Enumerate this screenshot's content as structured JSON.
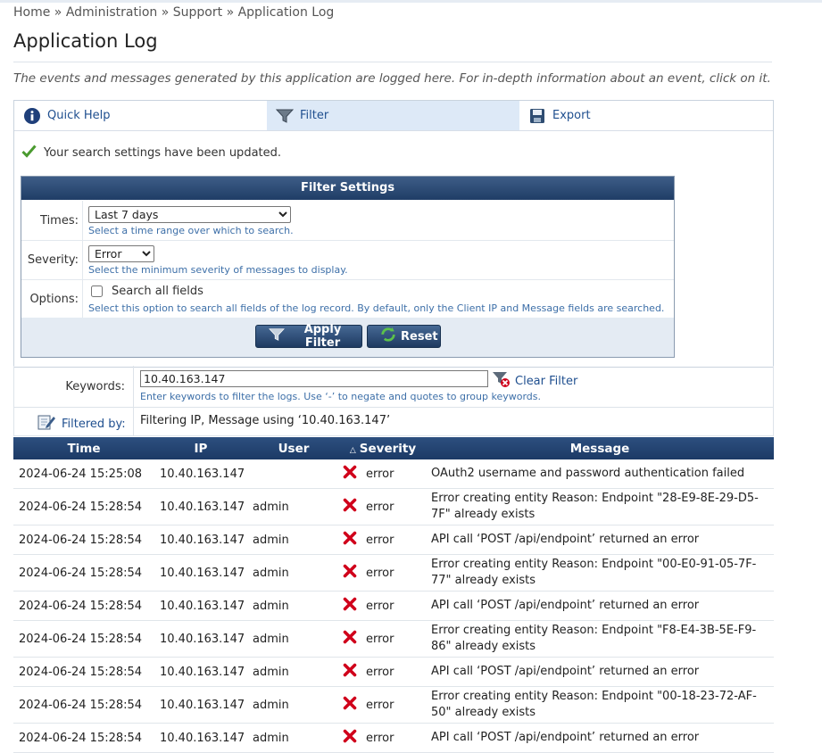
{
  "breadcrumb": {
    "home": "Home",
    "sep": "»",
    "administration": "Administration",
    "support": "Support",
    "current": "Application Log"
  },
  "page": {
    "title": "Application Log",
    "intro": "The events and messages generated by this application are logged here. For in-depth information about an event, click on it."
  },
  "tabs": [
    {
      "label": "Quick Help",
      "icon": "info-icon"
    },
    {
      "label": "Filter",
      "icon": "filter-icon"
    },
    {
      "label": "Export",
      "icon": "save-icon"
    }
  ],
  "status": {
    "message": "Your search settings have been updated."
  },
  "filter_settings": {
    "title": "Filter Settings",
    "times": {
      "label": "Times:",
      "value": "Last 7 days",
      "hint": "Select a time range over which to search."
    },
    "severity": {
      "label": "Severity:",
      "value": "Error",
      "hint": "Select the minimum severity of messages to display."
    },
    "options": {
      "label": "Options:",
      "checkbox_label": "Search all fields",
      "checked": false,
      "hint": "Select this option to search all fields of the log record. By default, only the Client IP and Message fields are searched."
    },
    "apply_label": "Apply Filter",
    "reset_label": "Reset"
  },
  "keywords": {
    "label": "Keywords:",
    "value": "10.40.163.147",
    "clear_label": "Clear Filter",
    "hint": "Enter keywords to filter the logs. Use ‘-’ to negate and quotes to group keywords."
  },
  "filtered_by": {
    "label": "Filtered by:",
    "text": "Filtering IP, Message using ‘10.40.163.147’"
  },
  "table": {
    "columns": {
      "time": "Time",
      "ip": "IP",
      "user": "User",
      "severity": "Severity",
      "message": "Message"
    },
    "severity_sort_indicator": "△",
    "rows": [
      {
        "time": "2024-06-24 15:25:08",
        "ip": "10.40.163.147",
        "user": "",
        "severity": "error",
        "message": "OAuth2 username and password authentication failed"
      },
      {
        "time": "2024-06-24 15:28:54",
        "ip": "10.40.163.147",
        "user": "admin",
        "severity": "error",
        "message": "Error creating entity Reason: Endpoint \"28-E9-8E-29-D5-7F\" already exists"
      },
      {
        "time": "2024-06-24 15:28:54",
        "ip": "10.40.163.147",
        "user": "admin",
        "severity": "error",
        "message": "API call ‘POST /api/endpoint’ returned an error"
      },
      {
        "time": "2024-06-24 15:28:54",
        "ip": "10.40.163.147",
        "user": "admin",
        "severity": "error",
        "message": "Error creating entity Reason: Endpoint \"00-E0-91-05-7F-77\" already exists"
      },
      {
        "time": "2024-06-24 15:28:54",
        "ip": "10.40.163.147",
        "user": "admin",
        "severity": "error",
        "message": "API call ‘POST /api/endpoint’ returned an error"
      },
      {
        "time": "2024-06-24 15:28:54",
        "ip": "10.40.163.147",
        "user": "admin",
        "severity": "error",
        "message": "Error creating entity Reason: Endpoint \"F8-E4-3B-5E-F9-86\" already exists"
      },
      {
        "time": "2024-06-24 15:28:54",
        "ip": "10.40.163.147",
        "user": "admin",
        "severity": "error",
        "message": "API call ‘POST /api/endpoint’ returned an error"
      },
      {
        "time": "2024-06-24 15:28:54",
        "ip": "10.40.163.147",
        "user": "admin",
        "severity": "error",
        "message": "Error creating entity Reason: Endpoint \"00-18-23-72-AF-50\" already exists"
      },
      {
        "time": "2024-06-24 15:28:54",
        "ip": "10.40.163.147",
        "user": "admin",
        "severity": "error",
        "message": "API call ‘POST /api/endpoint’ returned an error"
      }
    ]
  },
  "colors": {
    "link": "#1f4f8f",
    "header_bg": "#1c3a66",
    "hint": "#3d6fa8",
    "error": "#d0021b",
    "success": "#4a9a2f"
  }
}
